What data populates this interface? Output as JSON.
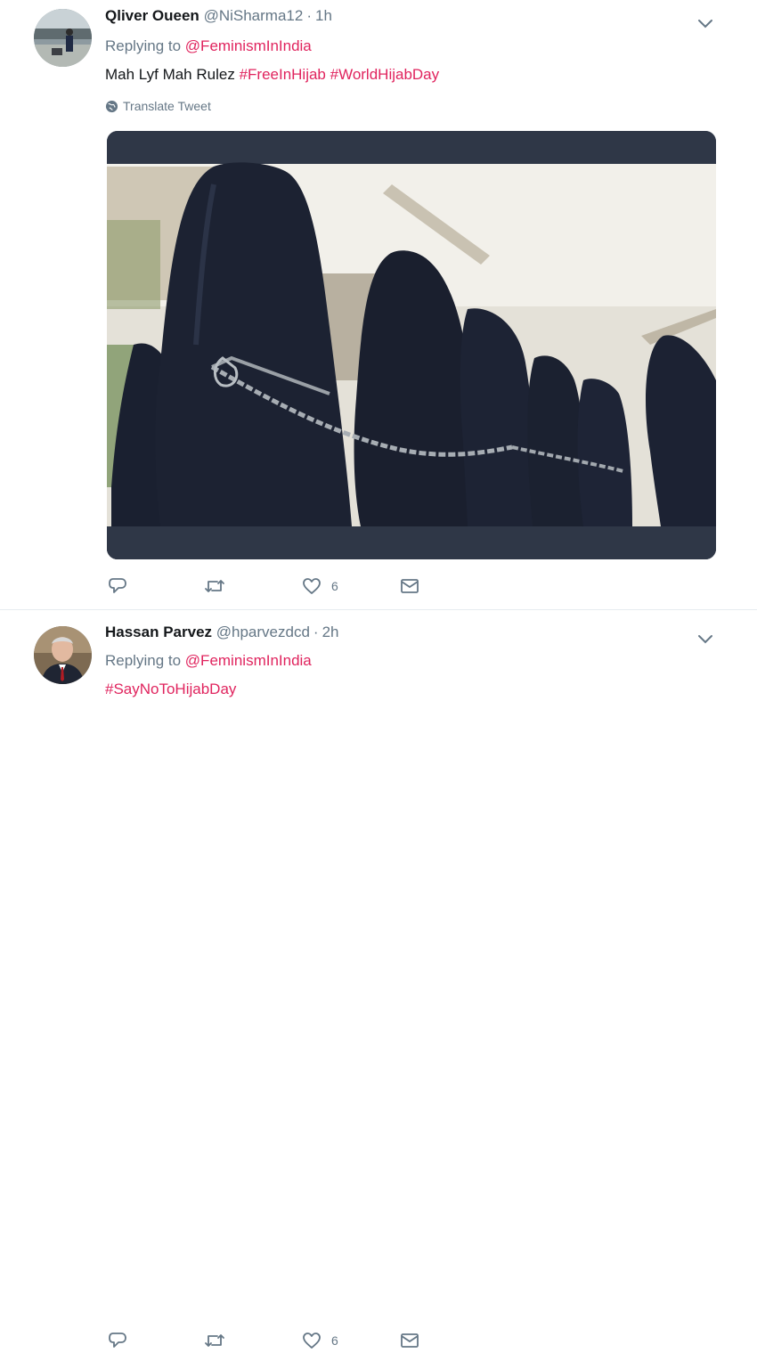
{
  "tweets": [
    {
      "author": {
        "name": "Qliver Oueen",
        "handle": "@NiSharma12",
        "time": "1h"
      },
      "replying_prefix": "Replying to",
      "replying_to": "@FeminismInIndia",
      "text_plain": "Mah Lyf Mah Rulez",
      "hashtags": [
        "#FreeInHijab",
        "#WorldHijabDay"
      ],
      "translate_label": "Translate Tweet",
      "likes": "6"
    },
    {
      "author": {
        "name": "Hassan Parvez",
        "handle": "@hparvezdcd",
        "time": "2h"
      },
      "replying_prefix": "Replying to",
      "replying_to": "@FeminismInIndia",
      "hashtags": [
        "#SayNoToHijabDay"
      ],
      "likes": "6"
    }
  ],
  "icons": {
    "dropdown": "chevron-down-icon",
    "translate": "globe-icon",
    "reply": "reply-icon",
    "retweet": "retweet-icon",
    "like": "heart-icon",
    "dm": "envelope-icon"
  },
  "colors": {
    "accent": "#e0245e",
    "muted": "#657786",
    "text": "#14171a"
  }
}
